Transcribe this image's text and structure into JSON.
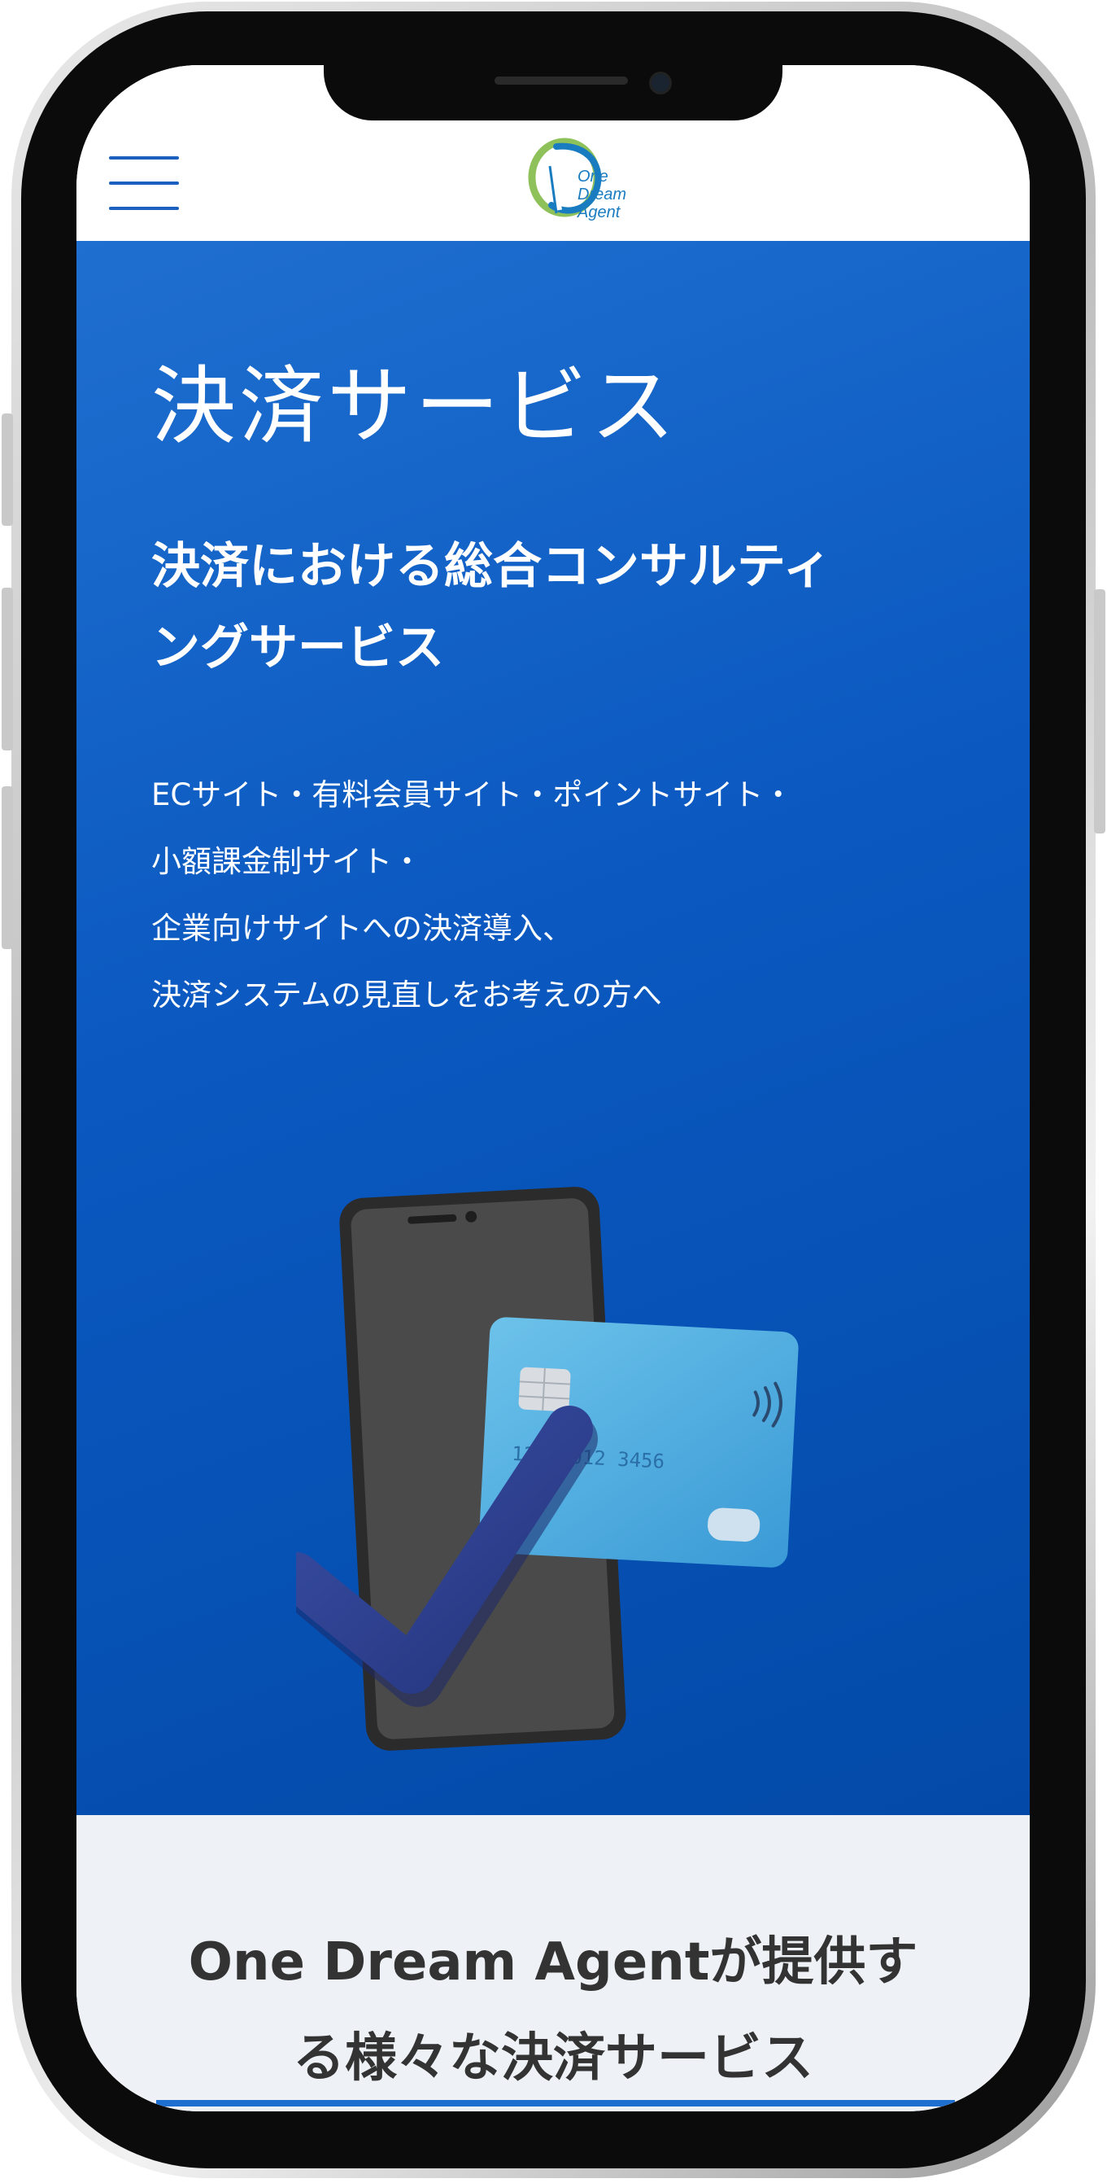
{
  "header": {
    "logo_text": [
      "One",
      "Dream",
      "Agent"
    ]
  },
  "hero": {
    "title": "決済サービス",
    "subtitle": [
      "決済における総合コンサルティ",
      "ングサービス"
    ],
    "description": [
      "ECサイト・有料会員サイト・ポイントサイト・",
      "小額課金制サイト・",
      "企業向けサイトへの決済導入、",
      "決済システムの見直しをお考えの方へ"
    ],
    "card_number_visible": "123 9012 3456"
  },
  "services": {
    "title": [
      "One Dream Agentが提供す",
      "る様々な決済サービス"
    ]
  },
  "colors": {
    "accent": "#1f6fd0",
    "hero_bg": "#0a58c0",
    "section_bg": "#eef2f6",
    "heading_text": "#333333"
  },
  "icons": [
    "hamburger-menu-icon",
    "one-dream-agent-logo",
    "phone-card-checkmark-illustration"
  ]
}
